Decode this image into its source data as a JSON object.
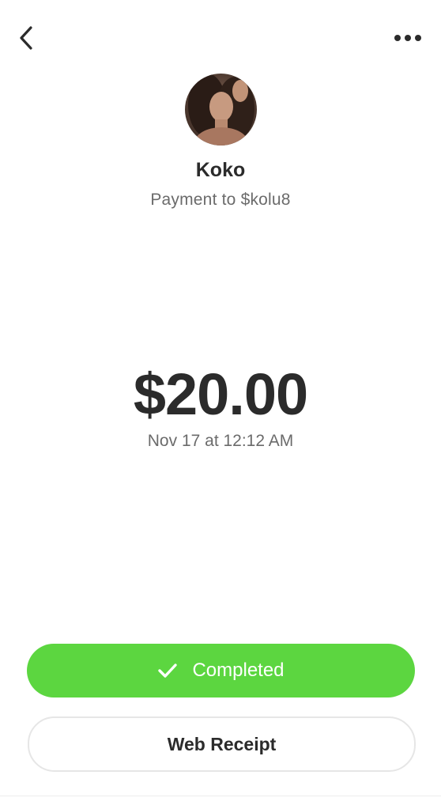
{
  "header": {
    "back_icon": "chevron-left-icon",
    "more_icon": "more-horizontal-icon"
  },
  "recipient": {
    "name": "Koko",
    "subtitle": "Payment to $kolu8"
  },
  "payment": {
    "amount": "$20.00",
    "timestamp": "Nov 17 at 12:12 AM"
  },
  "status": {
    "label": "Completed",
    "icon": "checkmark-icon",
    "color": "#5cd640"
  },
  "actions": {
    "receipt_label": "Web Receipt"
  }
}
